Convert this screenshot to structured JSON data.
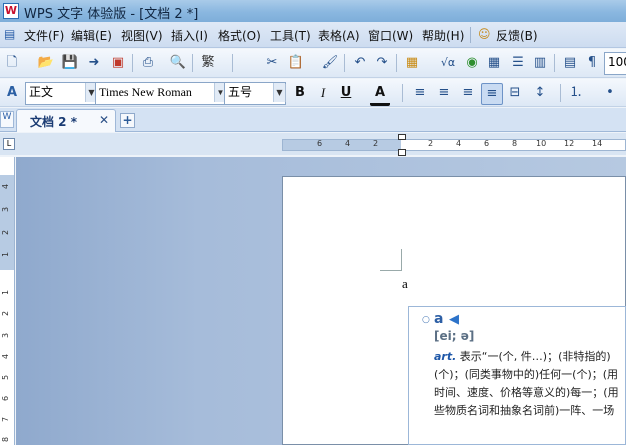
{
  "window": {
    "title": "WPS 文字 体验版 - [文档 2 *]",
    "app_icon": "W"
  },
  "menu": {
    "items": [
      "文件(F)",
      "编辑(E)",
      "视图(V)",
      "插入(I)",
      "格式(O)",
      "工具(T)",
      "表格(A)",
      "窗口(W)",
      "帮助(H)",
      "反馈(B)"
    ]
  },
  "toolbar": {
    "traditional_label": "繁",
    "zoom_value": "100",
    "sqrt_label": "√α"
  },
  "format_bar": {
    "style": "正文",
    "font": "Times New Roman",
    "size": "五号",
    "bold": "B",
    "italic": "I",
    "underline": "U",
    "font_color": "A"
  },
  "tabs": {
    "doc_tab": "文档 2 *",
    "close": "✕",
    "new_tab": "+"
  },
  "ruler": {
    "horizontal_ticks": [
      "6",
      "4",
      "2",
      "",
      "2",
      "4",
      "6",
      "8",
      "10",
      "12",
      "14"
    ],
    "vertical_ticks": [
      "4",
      "3",
      "2",
      "1",
      "",
      "1",
      "2",
      "3",
      "4",
      "5",
      "6",
      "7",
      "8"
    ],
    "corner": "L"
  },
  "document": {
    "body_text": "a"
  },
  "dictionary": {
    "word": "a",
    "phonetic": "[ei; ə]",
    "pos": "art.",
    "lines": [
      "表示“一(个, 件…)；(非特指的)",
      "(个)；(同类事物中的)任何一(个)；(用",
      "时间、速度、价格等意义的)每一；(用",
      "些物质名词和抽象名词前)一阵、一场"
    ]
  },
  "colors": {
    "accent": "#2d5fa5",
    "menubar": "#cddcf0",
    "workspace": "#a6bcda"
  }
}
